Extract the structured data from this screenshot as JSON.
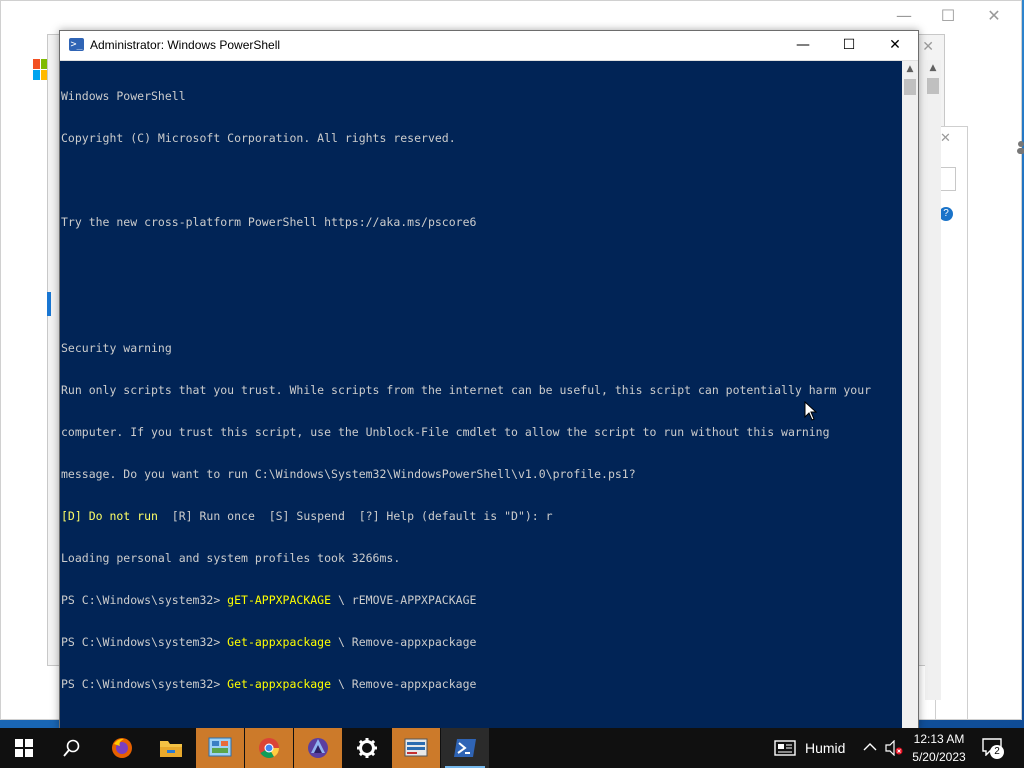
{
  "powershell": {
    "title": "Administrator: Windows PowerShell",
    "lines": [
      {
        "text": "Windows PowerShell",
        "style": "normal"
      },
      {
        "text": "Copyright (C) Microsoft Corporation. All rights reserved.",
        "style": "normal"
      },
      {
        "text": "",
        "style": "normal"
      },
      {
        "text": "Try the new cross-platform PowerShell https://aka.ms/pscore6",
        "style": "normal"
      },
      {
        "text": "",
        "style": "normal"
      },
      {
        "text": "",
        "style": "normal"
      },
      {
        "text": "Security warning",
        "style": "normal"
      },
      {
        "text": "Run only scripts that you trust. While scripts from the internet can be useful, this script can potentially harm your",
        "style": "normal"
      },
      {
        "text": "computer. If you trust this script, use the Unblock-File cmdlet to allow the script to run without this warning",
        "style": "normal"
      },
      {
        "text": "message. Do you want to run C:\\Windows\\System32\\WindowsPowerShell\\v1.0\\profile.ps1?",
        "style": "normal"
      },
      {
        "text": "",
        "style": "choices"
      },
      {
        "text": "Loading personal and system profiles took 3266ms.",
        "style": "normal"
      },
      {
        "text": "",
        "style": "prompt1"
      },
      {
        "text": "",
        "style": "prompt2"
      },
      {
        "text": "",
        "style": "prompt3"
      }
    ],
    "choices": {
      "default_option": "[D] Do not run",
      "rest": "  [R] Run once  [S] Suspend  [?] Help (default is \"D\"): r"
    },
    "prompts": [
      {
        "prompt": "PS C:\\Windows\\system32> ",
        "cmdlet": "gET-APPXPACKAGE",
        "rest": " \\ rEMOVE-APPXPACKAGE"
      },
      {
        "prompt": "PS C:\\Windows\\system32> ",
        "cmdlet": "Get-appxpackage",
        "rest": " \\ Remove-appxpackage"
      },
      {
        "prompt": "PS C:\\Windows\\system32> ",
        "cmdlet": "Get-appxpackage",
        "rest": " \\ Remove-appxpackage"
      }
    ]
  },
  "taskbar": {
    "apps": [
      {
        "name": "start-button",
        "icon": "windows-logo-icon"
      },
      {
        "name": "search-button",
        "icon": "search-icon"
      },
      {
        "name": "firefox",
        "icon": "firefox-icon"
      },
      {
        "name": "file-explorer",
        "icon": "folder-icon"
      },
      {
        "name": "control-panel",
        "icon": "control-panel-icon"
      },
      {
        "name": "chrome",
        "icon": "chrome-icon"
      },
      {
        "name": "media-app",
        "icon": "media-icon"
      },
      {
        "name": "settings",
        "icon": "gear-icon"
      },
      {
        "name": "server-manager",
        "icon": "server-manager-icon"
      },
      {
        "name": "powershell",
        "icon": "powershell-icon"
      }
    ],
    "weather": "Humid",
    "time": "12:13 AM",
    "date": "5/20/2023",
    "notification_count": "2"
  },
  "colors": {
    "console_bg": "#012456",
    "console_text": "#cccccc",
    "warning_text": "#ffff66",
    "cmdlet_text": "#ffff00",
    "taskbar_bg": "#101010",
    "active_app": "#cc7a2a"
  }
}
